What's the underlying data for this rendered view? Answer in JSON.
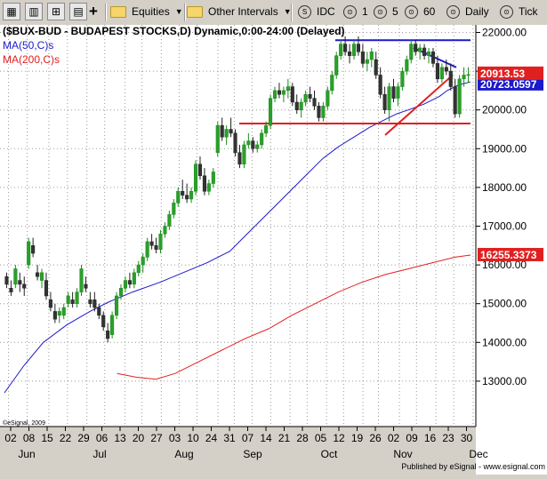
{
  "toolbar": {
    "equities_label": "Equities",
    "intervals_label": "Other Intervals",
    "idc_label": "IDC",
    "intervals": [
      "1",
      "5",
      "60"
    ],
    "daily_label": "Daily",
    "tick_label": "Tick"
  },
  "chart_data": {
    "type": "candlestick",
    "title": "($BUX-BUD - BUDAPEST STOCKS,D) Dynamic,0:00-24:00 (Delayed)",
    "ylim": [
      12500,
      22300
    ],
    "y_ticks": [
      13000,
      14000,
      15000,
      16000,
      17000,
      18000,
      19000,
      20000,
      21000,
      22000
    ],
    "y_tick_labels": [
      "13000.00",
      "14000.00",
      "15000.00",
      "16000.00",
      "17000.00",
      "18000.00",
      "19000.00",
      "20000.00",
      "21000.00",
      "22000.00"
    ],
    "x_tick_labels": [
      "02",
      "08",
      "15",
      "22",
      "29",
      "06",
      "13",
      "20",
      "27",
      "03",
      "10",
      "24",
      "31",
      "07",
      "14",
      "21",
      "28",
      "05",
      "12",
      "19",
      "26",
      "02",
      "09",
      "16",
      "23",
      "30"
    ],
    "month_labels": [
      "Jun",
      "Jul",
      "Aug",
      "Sep",
      "Oct",
      "Nov",
      "Dec"
    ],
    "grid": true,
    "last_price": 20913.53,
    "last_price_label": "20913.53",
    "ma50_label": "20723.0597",
    "ma200_label": "16255.3373",
    "series": [
      {
        "name": "MA(50,C)s",
        "color": "#1a1acc",
        "points": [
          [
            0,
            12700
          ],
          [
            5,
            13400
          ],
          [
            10,
            14000
          ],
          [
            16,
            14450
          ],
          [
            22,
            14800
          ],
          [
            27,
            15050
          ],
          [
            33,
            15300
          ],
          [
            40,
            15550
          ],
          [
            46,
            15800
          ],
          [
            52,
            16050
          ],
          [
            58,
            16350
          ],
          [
            62,
            16750
          ],
          [
            66,
            17150
          ],
          [
            70,
            17550
          ],
          [
            74,
            17950
          ],
          [
            78,
            18350
          ],
          [
            82,
            18750
          ],
          [
            86,
            19050
          ],
          [
            90,
            19300
          ],
          [
            94,
            19550
          ],
          [
            98,
            19750
          ],
          [
            101,
            19900
          ],
          [
            104,
            20000
          ],
          [
            108,
            20150
          ],
          [
            112,
            20350
          ],
          [
            114,
            20500
          ],
          [
            117,
            20650
          ],
          [
            120,
            20723
          ]
        ]
      },
      {
        "name": "MA(200,C)s",
        "color": "#e02020",
        "points": [
          [
            29,
            13200
          ],
          [
            34,
            13100
          ],
          [
            39,
            13050
          ],
          [
            44,
            13200
          ],
          [
            50,
            13500
          ],
          [
            56,
            13800
          ],
          [
            62,
            14100
          ],
          [
            68,
            14350
          ],
          [
            74,
            14700
          ],
          [
            80,
            15000
          ],
          [
            86,
            15300
          ],
          [
            92,
            15550
          ],
          [
            98,
            15750
          ],
          [
            104,
            15900
          ],
          [
            110,
            16050
          ],
          [
            116,
            16200
          ],
          [
            120,
            16255
          ]
        ]
      }
    ],
    "candles": [
      [
        15700,
        15800,
        15400,
        15500
      ],
      [
        15400,
        15600,
        15200,
        15300
      ],
      [
        15500,
        16000,
        15400,
        15900
      ],
      [
        15600,
        15800,
        15300,
        15500
      ],
      [
        15500,
        15700,
        15200,
        15400
      ],
      [
        16000,
        16700,
        15900,
        16600
      ],
      [
        16500,
        16700,
        16200,
        16300
      ],
      [
        15800,
        16000,
        15600,
        15700
      ],
      [
        15600,
        15900,
        15400,
        15800
      ],
      [
        15600,
        15800,
        15100,
        15200
      ],
      [
        15100,
        15300,
        14800,
        14900
      ],
      [
        14800,
        15000,
        14500,
        14600
      ],
      [
        14700,
        14900,
        14500,
        14800
      ],
      [
        14700,
        15000,
        14600,
        14900
      ],
      [
        15000,
        15300,
        14900,
        15200
      ],
      [
        15100,
        15300,
        14900,
        15000
      ],
      [
        15000,
        15400,
        14900,
        15300
      ],
      [
        15300,
        16000,
        15200,
        15900
      ],
      [
        15500,
        15700,
        15300,
        15400
      ],
      [
        15100,
        15300,
        14900,
        15000
      ],
      [
        15100,
        15300,
        14800,
        14900
      ],
      [
        14900,
        15000,
        14600,
        14700
      ],
      [
        14700,
        14800,
        14300,
        14400
      ],
      [
        14300,
        14500,
        14000,
        14100
      ],
      [
        14200,
        14800,
        14100,
        14700
      ],
      [
        14700,
        15300,
        14600,
        15200
      ],
      [
        15200,
        15500,
        15100,
        15400
      ],
      [
        15400,
        15700,
        15300,
        15600
      ],
      [
        15600,
        15800,
        15400,
        15500
      ],
      [
        15500,
        15900,
        15400,
        15800
      ],
      [
        15800,
        16100,
        15700,
        16000
      ],
      [
        16000,
        16300,
        15800,
        16200
      ],
      [
        16200,
        16700,
        16100,
        16600
      ],
      [
        16600,
        16800,
        16400,
        16500
      ],
      [
        16500,
        16700,
        16300,
        16400
      ],
      [
        16400,
        16900,
        16300,
        16800
      ],
      [
        16800,
        17100,
        16700,
        17000
      ],
      [
        17000,
        17400,
        16900,
        17300
      ],
      [
        17300,
        17700,
        17200,
        17600
      ],
      [
        17600,
        18000,
        17500,
        17900
      ],
      [
        17900,
        18200,
        17700,
        17800
      ],
      [
        17800,
        18100,
        17600,
        17700
      ],
      [
        17700,
        18000,
        17600,
        17900
      ],
      [
        17900,
        18700,
        17800,
        18600
      ],
      [
        18600,
        18800,
        18200,
        18300
      ],
      [
        18300,
        18500,
        17800,
        17900
      ],
      [
        17900,
        18200,
        17800,
        18100
      ],
      [
        18100,
        18500,
        18000,
        18400
      ],
      [
        18900,
        19700,
        18800,
        19600
      ],
      [
        19600,
        19800,
        19200,
        19300
      ],
      [
        19300,
        19600,
        19100,
        19500
      ],
      [
        19500,
        19800,
        19300,
        19400
      ],
      [
        19400,
        19500,
        18800,
        18900
      ],
      [
        18900,
        19100,
        18500,
        18600
      ],
      [
        18600,
        19200,
        18500,
        19100
      ],
      [
        19100,
        19400,
        19000,
        19200
      ],
      [
        19200,
        19300,
        18900,
        19000
      ],
      [
        19000,
        19200,
        18900,
        19100
      ],
      [
        19100,
        19500,
        19000,
        19400
      ],
      [
        19400,
        19700,
        19300,
        19600
      ],
      [
        19600,
        20400,
        19500,
        20300
      ],
      [
        20300,
        20600,
        20200,
        20500
      ],
      [
        20500,
        20700,
        20300,
        20400
      ],
      [
        20400,
        20600,
        20200,
        20500
      ],
      [
        20500,
        20800,
        20300,
        20600
      ],
      [
        20600,
        20700,
        20100,
        20200
      ],
      [
        20200,
        20400,
        19900,
        20000
      ],
      [
        20000,
        20300,
        19800,
        20200
      ],
      [
        20200,
        20500,
        20100,
        20400
      ],
      [
        20400,
        20600,
        20200,
        20300
      ],
      [
        20300,
        20500,
        20000,
        20100
      ],
      [
        20100,
        20200,
        19700,
        19800
      ],
      [
        19800,
        20200,
        19700,
        20100
      ],
      [
        20100,
        20600,
        20000,
        20500
      ],
      [
        20500,
        21000,
        20400,
        20900
      ],
      [
        20900,
        21500,
        20800,
        21400
      ],
      [
        21400,
        21800,
        21300,
        21700
      ],
      [
        21700,
        21900,
        21400,
        21500
      ],
      [
        21500,
        21700,
        21200,
        21400
      ],
      [
        21400,
        21800,
        21300,
        21700
      ],
      [
        21700,
        21900,
        21400,
        21500
      ],
      [
        21500,
        21700,
        21100,
        21200
      ],
      [
        21200,
        21500,
        21000,
        21300
      ],
      [
        21300,
        21600,
        21100,
        21500
      ],
      [
        21300,
        21500,
        20800,
        20900
      ],
      [
        20900,
        21100,
        20300,
        20400
      ],
      [
        20400,
        20600,
        19900,
        20000
      ],
      [
        20000,
        20700,
        19700,
        20600
      ],
      [
        20600,
        20800,
        20200,
        20300
      ],
      [
        20300,
        20700,
        20100,
        20600
      ],
      [
        20600,
        21100,
        20500,
        21000
      ],
      [
        21000,
        21400,
        20900,
        21300
      ],
      [
        21300,
        21800,
        21200,
        21700
      ],
      [
        21700,
        21800,
        21400,
        21500
      ],
      [
        21500,
        21700,
        21300,
        21600
      ],
      [
        21600,
        21700,
        21300,
        21400
      ],
      [
        21400,
        21600,
        21200,
        21500
      ],
      [
        21500,
        21600,
        21100,
        21200
      ],
      [
        21200,
        21400,
        20700,
        20800
      ],
      [
        20800,
        21200,
        20700,
        21100
      ],
      [
        21100,
        21300,
        20900,
        21000
      ],
      [
        21000,
        21200,
        20500,
        20600
      ],
      [
        20600,
        20800,
        19800,
        19900
      ],
      [
        19900,
        20900,
        19800,
        20800
      ],
      [
        20800,
        21100,
        20600,
        20900
      ],
      [
        20900,
        21100,
        20700,
        20913
      ]
    ],
    "trend_lines": [
      {
        "color": "#1a1acc",
        "from": [
          93,
          21800
        ],
        "to": [
          131,
          21800
        ]
      },
      {
        "color": "#e02020",
        "from": [
          66,
          19650
        ],
        "to": [
          131,
          19650
        ]
      },
      {
        "color": "#1a1acc",
        "from": [
          115,
          21600
        ],
        "to": [
          127,
          21100
        ]
      },
      {
        "color": "#e02020",
        "from": [
          107,
          19350
        ],
        "to": [
          126,
          20900
        ]
      }
    ],
    "copyright": "©eSignal, 2009",
    "footer": "Published by eSignal - www.esignal.com"
  }
}
